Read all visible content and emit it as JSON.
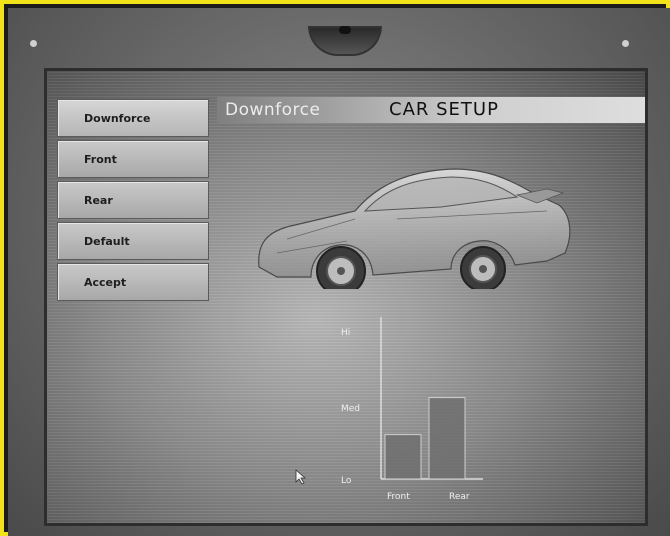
{
  "menu": {
    "items": [
      {
        "label": "Downforce",
        "active": true
      },
      {
        "label": "Front",
        "active": false
      },
      {
        "label": "Rear",
        "active": false
      },
      {
        "label": "Default",
        "active": false
      },
      {
        "label": "Accept",
        "active": false
      }
    ]
  },
  "header": {
    "section": "Downforce",
    "title": "CAR SETUP"
  },
  "chart_data": {
    "type": "bar",
    "categories": [
      "Front",
      "Rear"
    ],
    "values": [
      0.3,
      0.55
    ],
    "yticks": [
      "Hi",
      "Med",
      "Lo"
    ],
    "ylim": [
      0,
      1
    ]
  },
  "colors": {
    "border": "#f2e21a",
    "bar": "#6f6f6f"
  }
}
